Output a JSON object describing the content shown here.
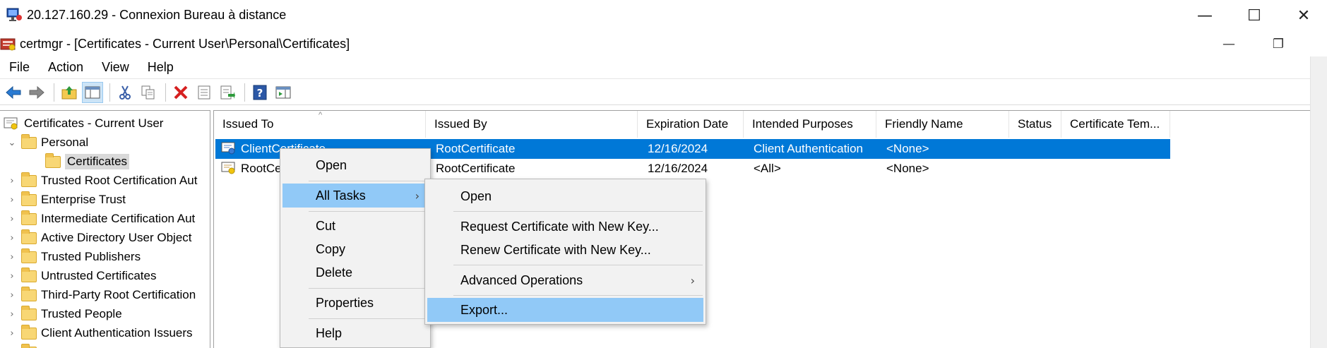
{
  "rdp_window": {
    "title": "20.127.160.29 - Connexion Bureau à distance",
    "controls": {
      "minimize": "—",
      "maximize": "☐",
      "close": "✕"
    }
  },
  "certmgr_window": {
    "title": "certmgr - [Certificates - Current User\\Personal\\Certificates]",
    "controls": {
      "minimize": "—",
      "restore": "❐"
    }
  },
  "menu": [
    "File",
    "Action",
    "View",
    "Help"
  ],
  "toolbar": {
    "buttons": [
      "back-icon",
      "forward-icon",
      "up-folder-icon",
      "show-hide-tree-icon",
      "cut-icon",
      "copy-icon",
      "delete-icon",
      "properties-icon",
      "export-list-icon",
      "help-icon",
      "action-pane-icon"
    ]
  },
  "tree": {
    "root": "Certificates - Current User",
    "personal": "Personal",
    "certificates": "Certificates",
    "items": [
      "Trusted Root Certification Aut",
      "Enterprise Trust",
      "Intermediate Certification Aut",
      "Active Directory User Object",
      "Trusted Publishers",
      "Untrusted Certificates",
      "Third-Party Root Certification",
      "Trusted People",
      "Client Authentication Issuers"
    ]
  },
  "list": {
    "columns": [
      "Issued To",
      "Issued By",
      "Expiration Date",
      "Intended Purposes",
      "Friendly Name",
      "Status",
      "Certificate Tem..."
    ],
    "sort_indicator": "^",
    "rows": [
      {
        "issued_to": "ClientCertificate",
        "issued_by": "RootCertificate",
        "expiration": "12/16/2024",
        "purposes": "Client Authentication",
        "friendly_name": "<None>",
        "status": "",
        "template": ""
      },
      {
        "issued_to": "RootCe",
        "issued_by": "RootCertificate",
        "expiration": "12/16/2024",
        "purposes": "<All>",
        "friendly_name": "<None>",
        "status": "",
        "template": ""
      }
    ]
  },
  "context_menu": {
    "open": "Open",
    "all_tasks": "All Tasks",
    "cut": "Cut",
    "copy": "Copy",
    "delete": "Delete",
    "properties": "Properties",
    "help": "Help",
    "submenu_arrow": "›"
  },
  "submenu": {
    "open": "Open",
    "request_new_key": "Request Certificate with New Key...",
    "renew_new_key": "Renew Certificate with New Key...",
    "advanced": "Advanced Operations",
    "export": "Export..."
  },
  "colors": {
    "selection": "#0078d7",
    "menu_highlight": "#91c9f7",
    "tree_selected": "#d9d9d9"
  }
}
